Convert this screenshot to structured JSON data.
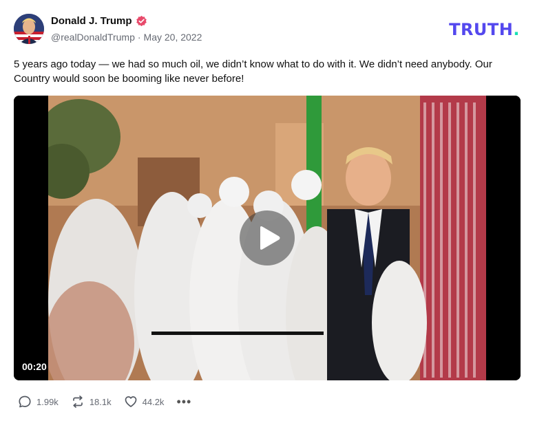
{
  "author": {
    "display_name": "Donald J. Trump",
    "handle": "@realDonaldTrump",
    "separator": "·",
    "date": "May 20, 2022",
    "verified_icon": "verified-badge-icon"
  },
  "brand": {
    "logo_text": "TRUTH",
    "logo_dot": ".",
    "primary_color": "#5448ee",
    "accent_color": "#17e0b4"
  },
  "post": {
    "text": "5 years ago today — we had so much oil, we didn’t know what to do with it. We didn’t need anybody. Our Country would soon be booming like never before!"
  },
  "video": {
    "duration": "00:20",
    "play_icon": "play-icon"
  },
  "actions": {
    "replies": "1.99k",
    "retruths": "18.1k",
    "likes": "44.2k",
    "more": "•••"
  }
}
